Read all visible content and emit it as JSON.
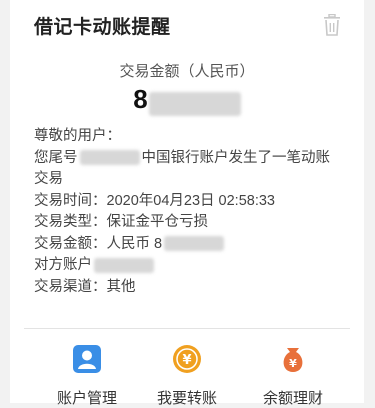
{
  "notification": {
    "title": "借记卡动账提醒",
    "amount_label": "交易金额（人民币）",
    "amount_visible": "8",
    "details": {
      "greeting": "尊敬的用户：",
      "line1_prefix": "您尾号",
      "line1_suffix": "中国银行账户发生了一笔动账",
      "line2": "交易",
      "time_label": "交易时间：",
      "time_value": "2020年04月23日 02:58:33",
      "type_label": "交易类型：",
      "type_value": "保证金平仓亏损",
      "amount_label": "交易金额：",
      "amount_value": "人民币 8",
      "counterparty_label": "对方账户",
      "channel_label": "交易渠道：",
      "channel_value": "其他"
    }
  },
  "actions": [
    {
      "label": "账户管理",
      "icon": "account-manage-icon",
      "color": "#3a8ee6"
    },
    {
      "label": "我要转账",
      "icon": "transfer-icon",
      "color": "#f0a020"
    },
    {
      "label": "余额理财",
      "icon": "wealth-icon",
      "color": "#e8703a"
    }
  ]
}
